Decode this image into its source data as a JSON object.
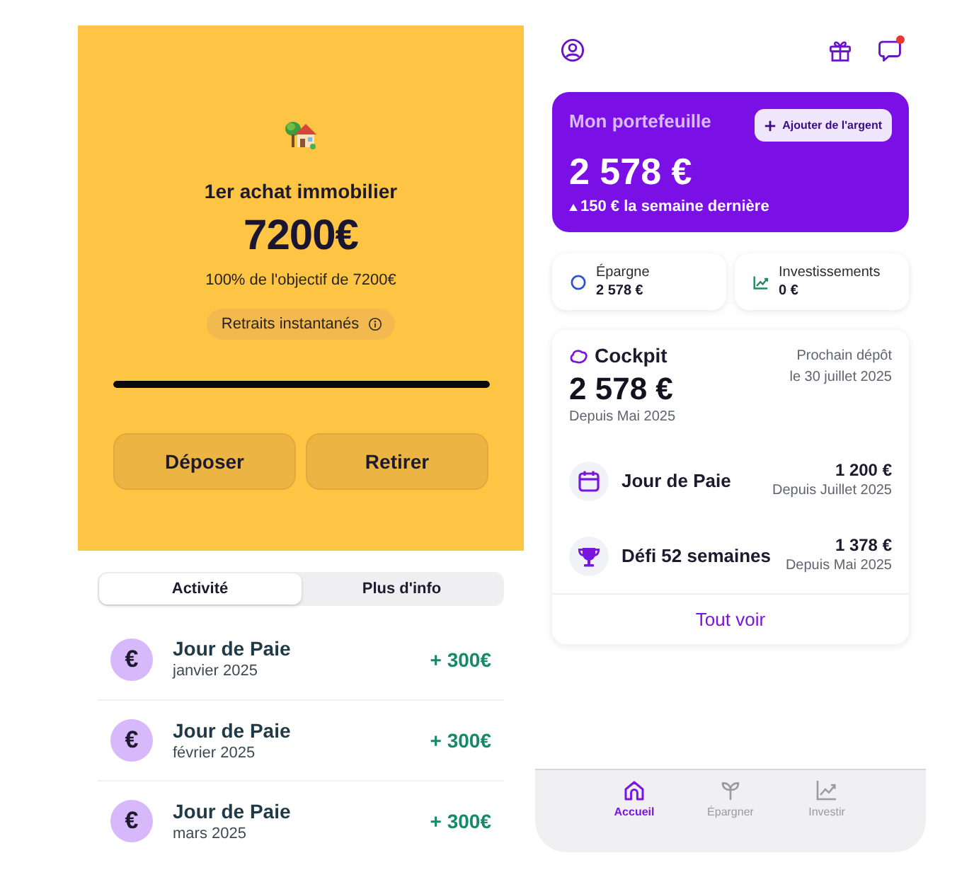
{
  "goal": {
    "title": "1er achat immobilier",
    "amount": "7200€",
    "progress_text": "100% de l'objectif de 7200€",
    "chip": "Retraits instantanés",
    "level": 1,
    "buttons": [
      "Déposer",
      "Retirer"
    ]
  },
  "tabs": [
    {
      "label": "Activité",
      "selected": true
    },
    {
      "label": "Plus d'info",
      "selected": false
    }
  ],
  "activity": [
    {
      "icon": "€",
      "title": "Jour de Paie",
      "date": "janvier 2025",
      "amount": "+ 300€"
    },
    {
      "icon": "€",
      "title": "Jour de Paie",
      "date": "février 2025",
      "amount": "+ 300€"
    },
    {
      "icon": "€",
      "title": "Jour de Paie",
      "date": "mars 2025",
      "amount": "+ 300€"
    }
  ],
  "header": {
    "notification": true
  },
  "wallet": {
    "title": "Mon portefeuille",
    "button": "Ajouter de l'argent",
    "amount": "2 578 €",
    "change": "150 € la semaine dernière"
  },
  "accounts": [
    {
      "kind": "savings",
      "label": "Épargne",
      "amount": "2 578 €"
    },
    {
      "kind": "investments",
      "label": "Investissements",
      "amount": "0 €"
    }
  ],
  "cockpit": {
    "title": "Cockpit",
    "amount": "2 578 €",
    "since": "Depuis Mai 2025",
    "next_label": "Prochain dépôt",
    "next_date": "le 30 juillet 2025",
    "items": [
      {
        "kind": "calendar",
        "name": "Jour de Paie",
        "amount": "1 200 €",
        "since": "Depuis Juillet 2025"
      },
      {
        "kind": "trophy",
        "name": "Défi 52 semaines",
        "amount": "1 378 €",
        "since": "Depuis Mai 2025"
      }
    ],
    "link": "Tout voir"
  },
  "nav": [
    {
      "kind": "home",
      "label": "Accueil",
      "selected": true
    },
    {
      "kind": "sprout",
      "label": "Épargner",
      "selected": false
    },
    {
      "kind": "chart",
      "label": "Investir",
      "selected": false
    }
  ]
}
